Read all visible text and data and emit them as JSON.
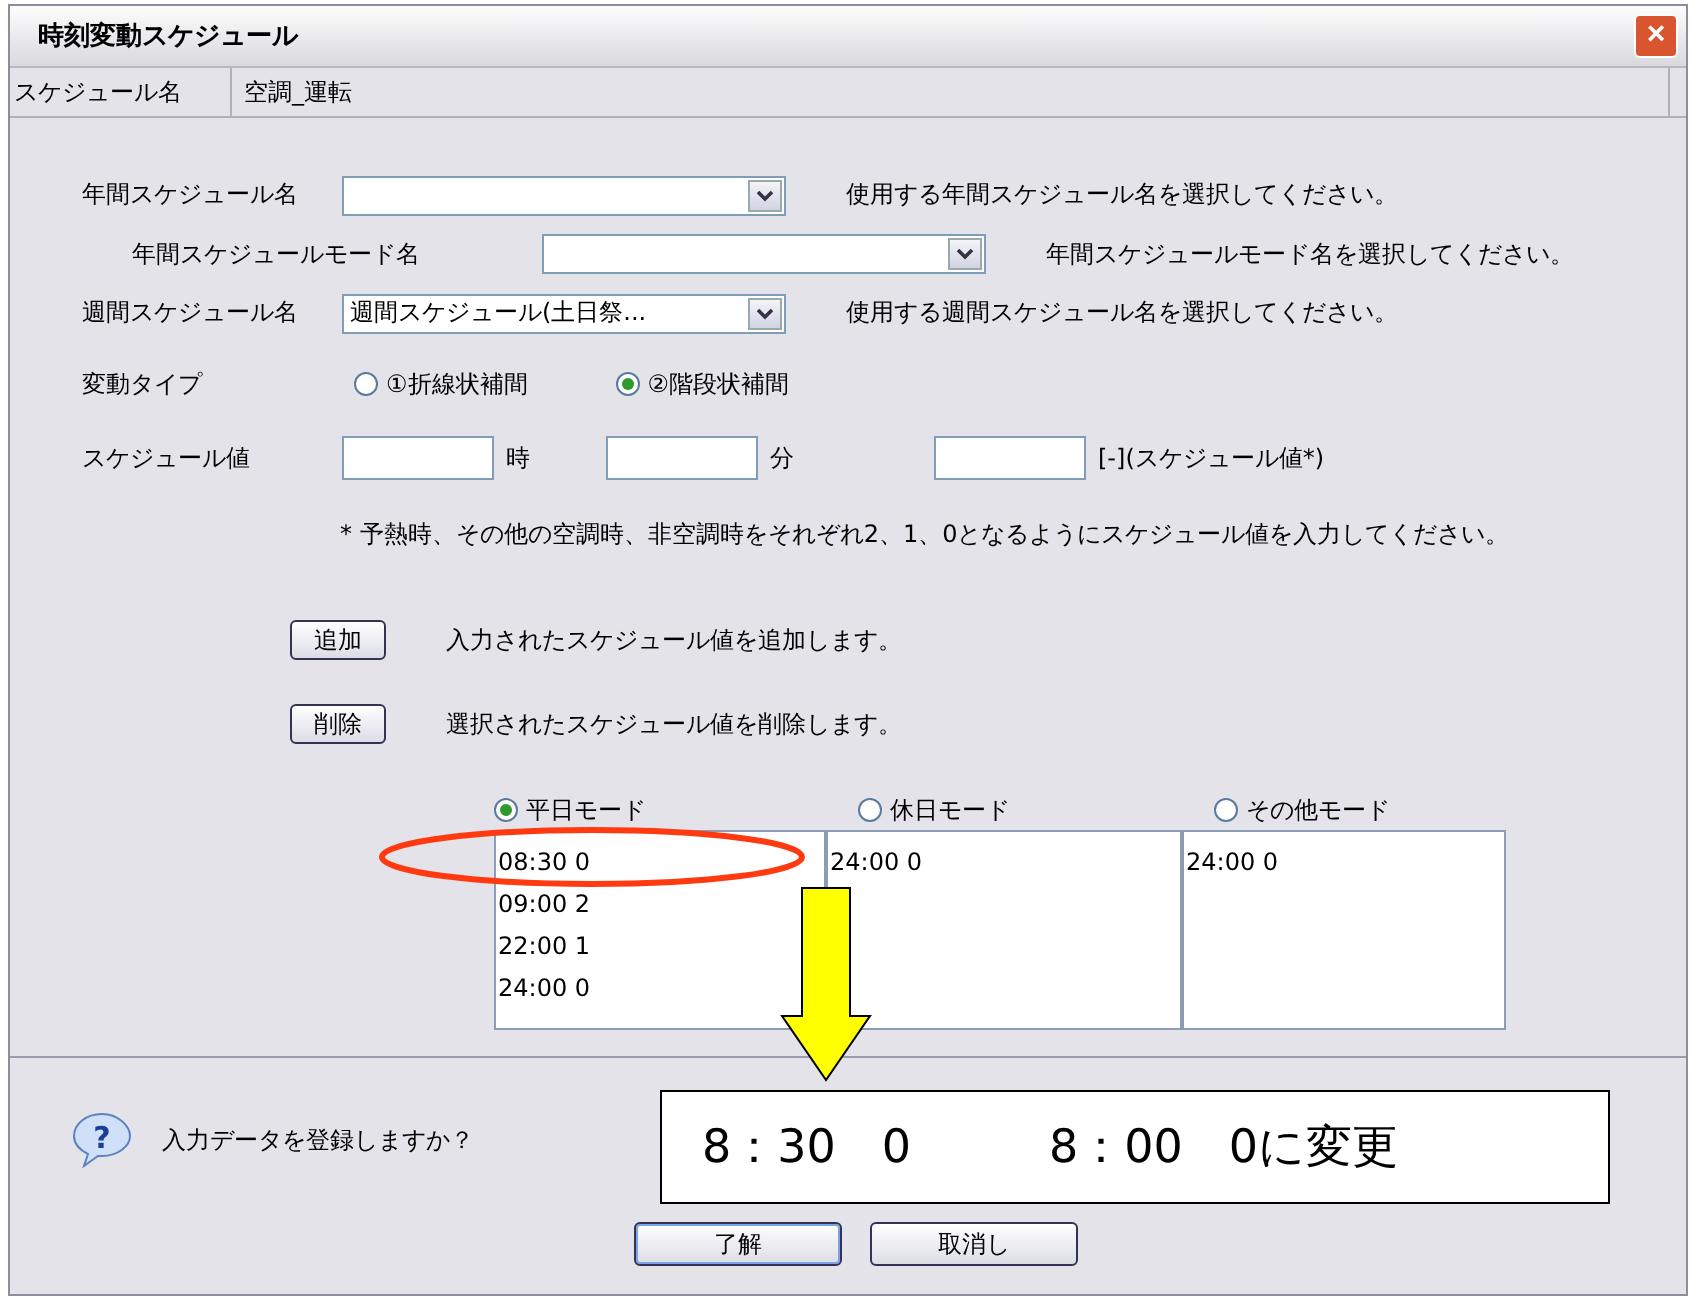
{
  "window": {
    "title": "時刻変動スケジュール",
    "close": "×"
  },
  "schedule_name": {
    "label": "スケジュール名",
    "value": "空調_運転"
  },
  "combos": [
    {
      "label": "年間スケジュール名",
      "hint": "使用する年間スケジュール名を選択してください。",
      "indent": false
    },
    {
      "label": "年間スケジュールモード名",
      "hint": "年間スケジュールモード名を選択してください。",
      "indent": true
    },
    {
      "label": "週間スケジュール名",
      "value": "週間スケジュール(土日祭...",
      "hint": "使用する週間スケジュール名を選択してください。",
      "indent": false
    }
  ],
  "variation_type": {
    "label": "変動タイプ",
    "options": [
      {
        "label": "①折線状補間",
        "selected": false
      },
      {
        "label": "②階段状補間",
        "selected": true
      }
    ]
  },
  "schedule_value": {
    "label": "スケジュール値",
    "hour_unit": "時",
    "minute_unit": "分",
    "value_unit": "[-](スケジュール値*)"
  },
  "note": "* 予熱時、その他の空調時、非空調時をそれぞれ2、1、0となるようにスケジュール値を入力してください。",
  "actions": [
    {
      "button": "追加",
      "text": "入力されたスケジュール値を追加します。"
    },
    {
      "button": "削除",
      "text": "選択されたスケジュール値を削除します。"
    }
  ],
  "modes": [
    {
      "label": "平日モード",
      "selected": true,
      "items": [
        "08:30 0",
        "09:00 2",
        "22:00 1",
        "24:00 0"
      ]
    },
    {
      "label": "休日モード",
      "selected": false,
      "items": [
        "24:00 0"
      ]
    },
    {
      "label": "その他モード",
      "selected": false,
      "items": [
        "24:00 0"
      ]
    }
  ],
  "confirm": {
    "icon": "?",
    "question": "入力データを登録しますか？",
    "buttons": [
      "了解",
      "取消し"
    ]
  },
  "annotation": {
    "callout": "8：30　0　　　8：00　0に変更"
  }
}
